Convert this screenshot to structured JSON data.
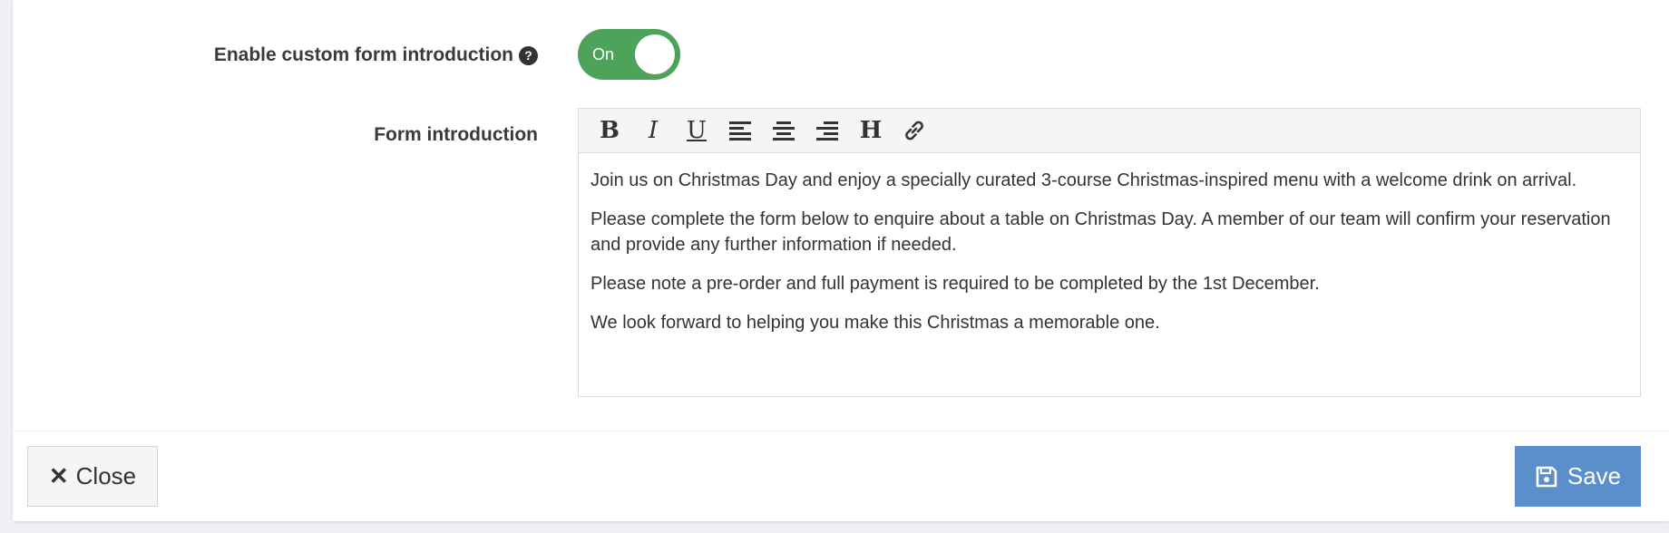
{
  "fields": {
    "custom_intro_label": "Enable custom form introduction",
    "help_glyph": "?",
    "toggle_state": "On",
    "form_intro_label": "Form introduction"
  },
  "editor": {
    "toolbar": [
      {
        "name": "bold-button",
        "glyph": "B",
        "icon": "bold-icon"
      },
      {
        "name": "italic-button",
        "glyph": "I",
        "icon": "italic-icon"
      },
      {
        "name": "underline-button",
        "glyph": "U",
        "icon": "underline-icon"
      },
      {
        "name": "align-left-button",
        "glyph": "",
        "icon": "align-left-icon"
      },
      {
        "name": "align-center-button",
        "glyph": "",
        "icon": "align-center-icon"
      },
      {
        "name": "align-right-button",
        "glyph": "",
        "icon": "align-right-icon"
      },
      {
        "name": "heading-button",
        "glyph": "H",
        "icon": "heading-icon"
      },
      {
        "name": "link-button",
        "glyph": "",
        "icon": "link-icon"
      }
    ],
    "paragraphs": [
      "Join us on Christmas Day and enjoy a specially curated 3-course Christmas-inspired menu with a welcome drink on arrival.",
      "Please complete the form below to enquire about a table on Christmas Day. A member of our team will confirm your reservation and provide any further information if needed.",
      "Please note a pre-order and full payment is required to be completed by the 1st December.",
      "We look forward to helping you make this Christmas a memorable one."
    ]
  },
  "footer": {
    "close_glyph": "✕",
    "close_label": "Close",
    "save_label": "Save"
  },
  "colors": {
    "toggle_on": "#4da35a",
    "save_button": "#5b8fcb",
    "close_button": "#f5f5f5"
  }
}
